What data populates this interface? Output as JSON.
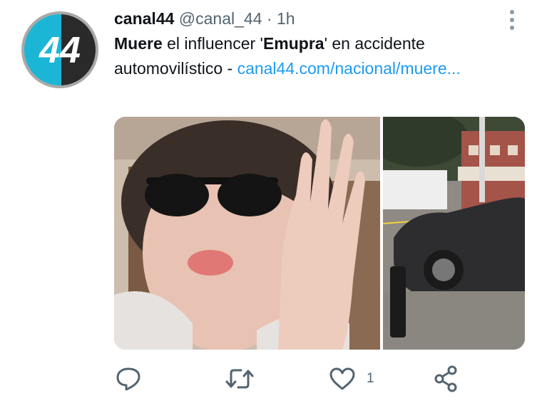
{
  "tweet": {
    "author_name": "canal44",
    "handle": "@canal_44",
    "separator": "·",
    "time": "1h",
    "avatar_label": "44",
    "text_parts": {
      "bold1": "Muere",
      "t1": " el influencer '",
      "bold2": "Emupra",
      "t2": "' en accidente automovilístico - ",
      "link": "canal44.com/nacional/muere..."
    }
  },
  "actions": {
    "reply_icon": "reply-icon",
    "retweet_icon": "retweet-icon",
    "like_icon": "heart-icon",
    "like_count": "1",
    "share_icon": "share-icon"
  },
  "colors": {
    "accent": "#1d9bf0",
    "avatar_cyan": "#1bb6d6",
    "avatar_dark": "#2a2a2a",
    "secondary_text": "#536471"
  }
}
